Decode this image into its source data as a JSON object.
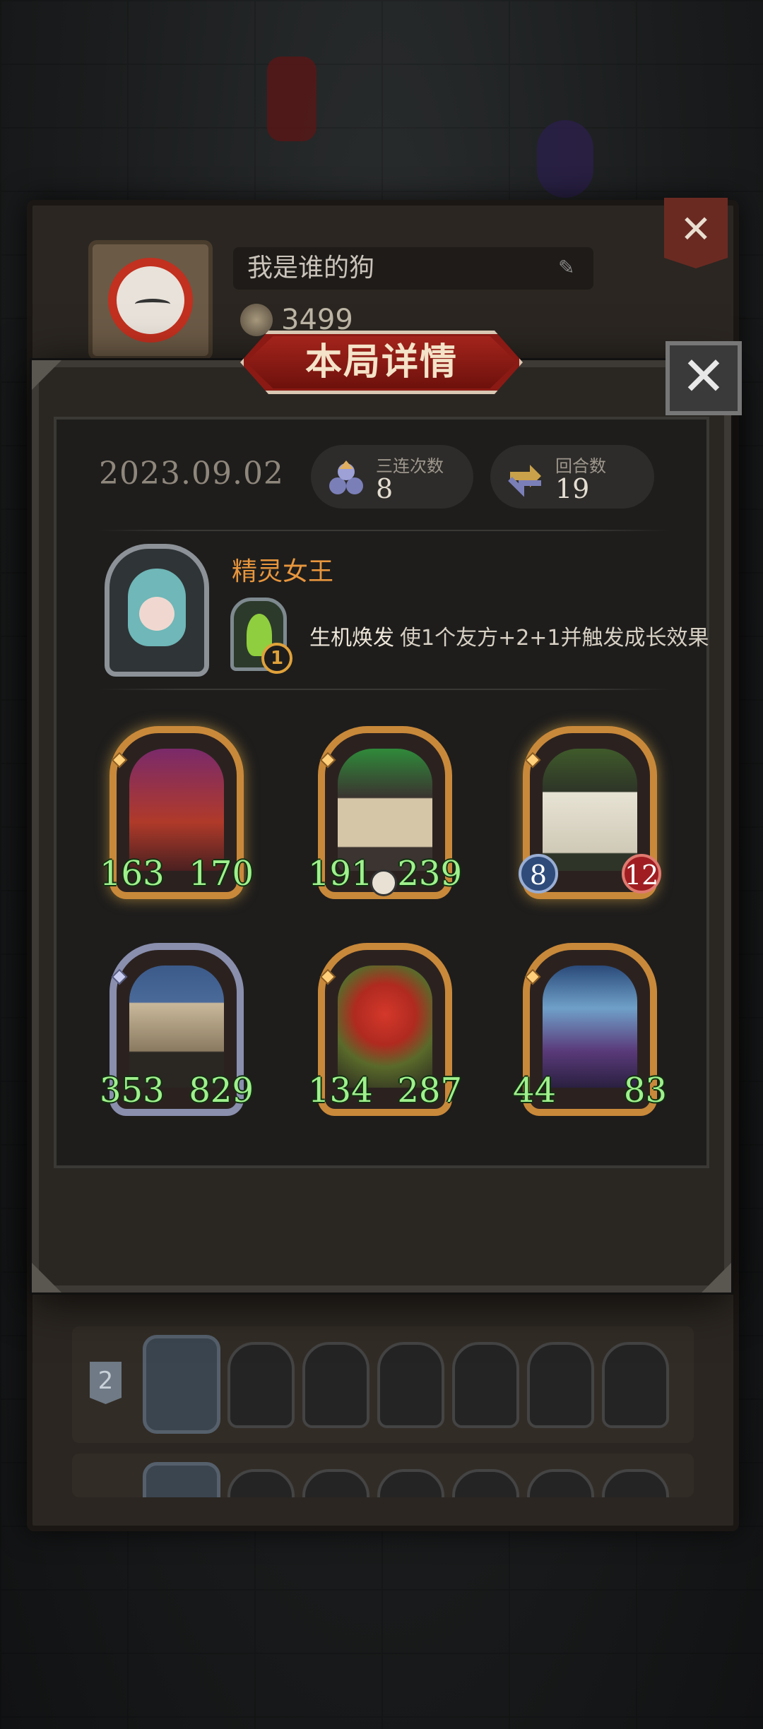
{
  "background": {
    "profile": {
      "player_name": "我是谁的狗",
      "coins": "3499",
      "row_rank": "2"
    }
  },
  "modal": {
    "title": "本局详情",
    "close_icon": "✕",
    "date": "2023.09.02",
    "stats": [
      {
        "label": "三连次数",
        "value": "8",
        "icon": "triple-icon"
      },
      {
        "label": "回合数",
        "value": "19",
        "icon": "rounds-icon"
      }
    ],
    "hero": {
      "name": "精灵女王",
      "skill_level": "1",
      "skill_name": "生机焕发",
      "skill_desc": "使1个友方+2+1并触发成长效果"
    },
    "cards": [
      {
        "atk": "163",
        "hp": "170",
        "style": "plain"
      },
      {
        "atk": "191",
        "hp": "239",
        "style": "skull"
      },
      {
        "atk": "8",
        "hp": "12",
        "style": "badge"
      },
      {
        "atk": "353",
        "hp": "829",
        "style": "silver"
      },
      {
        "atk": "134",
        "hp": "287",
        "style": "plain"
      },
      {
        "atk": "44",
        "hp": "83",
        "style": "plain"
      }
    ]
  },
  "colors": {
    "accent_gold": "#c9893a",
    "title_red": "#8b1a14",
    "stat_green": "#9ff08c",
    "hero_name_orange": "#e8963d"
  }
}
